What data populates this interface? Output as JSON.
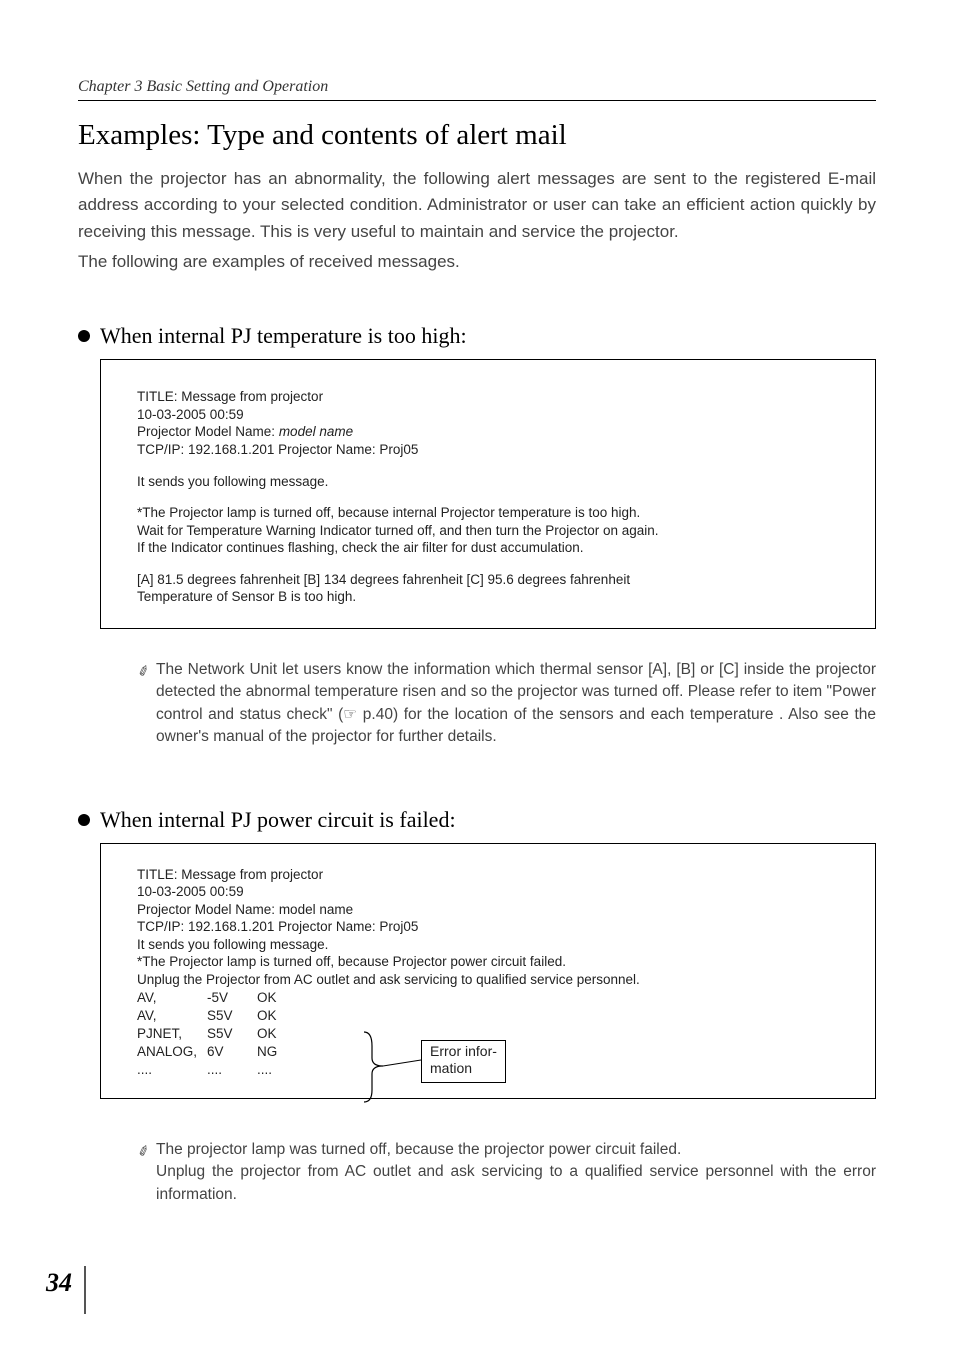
{
  "chapter_header": "Chapter 3 Basic Setting and Operation",
  "main_title": "Examples: Type and contents of alert mail",
  "intro_para": "When the projector has an abnormality, the following alert messages are sent to the registered E-mail address according to your selected condition. Administrator or user can take an efficient action quickly by receiving this message. This is very useful to maintain and service the projector.",
  "following_line": "The following are examples of received messages.",
  "section1": {
    "heading": "When internal PJ temperature is too high:",
    "msg": {
      "title_line": "TITLE: Message from projector",
      "date_line": "10-03-2005 00:59",
      "model_prefix": "Projector Model Name: ",
      "model_name": "model name",
      "tcp_line": "TCP/IP: 192.168.1.201 Projector Name: Proj05",
      "sends_line": "It sends you following message.",
      "body1": "*The Projector lamp is turned off, because internal Projector temperature is too high.",
      "body2": " Wait for Temperature Warning Indicator turned off, and then turn the Projector on again.",
      "body3": " If the Indicator continues flashing, check the air filter for dust accumulation.",
      "temps_line": "[A] 81.5 degrees fahrenheit [B] 134 degrees fahrenheit  [C] 95.6 degrees fahrenheit",
      "sensor_line": "Temperature of Sensor B is too high."
    },
    "note": "The Network Unit let users know the information which thermal sensor [A], [B] or [C] inside the projector detected the abnormal temperature risen and so the projector was turned off. Please refer to item \"Power control and status check\" (☞ p.40) for the location of the sensors and each temperature . Also see the owner's manual of the projector for further details."
  },
  "section2": {
    "heading": "When internal PJ power circuit is failed:",
    "msg": {
      "title_line": "TITLE: Message from projector",
      "date_line": "10-03-2005 00:59",
      "model_prefix": "Projector Model Name: ",
      "model_name": "model name",
      "tcp_line": "TCP/IP: 192.168.1.201 Projector Name: Proj05",
      "sends_line": "It sends you following message.",
      "body1": "*The Projector lamp is turned off, because Projector power circuit failed.",
      "body2": "Unplug the Projector from AC outlet and ask servicing to qualified service personnel.",
      "rows": [
        {
          "c1": "AV,",
          "c2": "-5V",
          "c3": "OK"
        },
        {
          "c1": "AV,",
          "c2": "S5V",
          "c3": "OK"
        },
        {
          "c1": "PJNET,",
          "c2": "S5V",
          "c3": "OK"
        },
        {
          "c1": "ANALOG,",
          "c2": "6V",
          "c3": "NG"
        },
        {
          "c1": "....",
          "c2": "....",
          "c3": "...."
        }
      ],
      "callout_l1": "Error infor-",
      "callout_l2": "mation"
    },
    "note_l1": "The projector lamp was turned off, because the projector power circuit failed.",
    "note_l2": "Unplug the projector from AC outlet and ask servicing to a qualified service personnel with the error information."
  },
  "page_number": "34"
}
